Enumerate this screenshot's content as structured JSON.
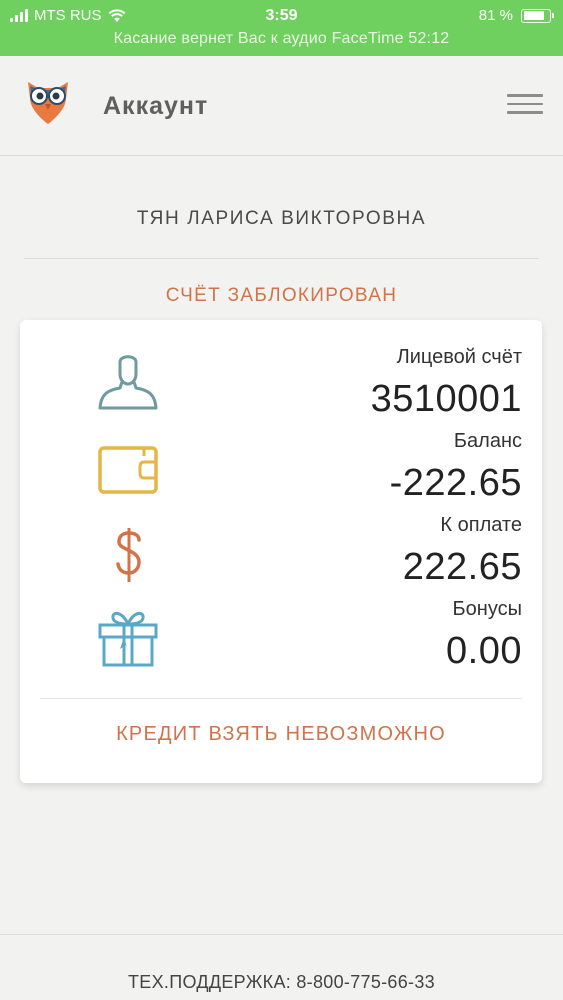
{
  "status_bar": {
    "carrier": "MTS RUS",
    "time": "3:59",
    "battery_percent": "81 %",
    "battery_level": 0.81,
    "facetime_banner": "Касание вернет Вас к аудио FaceTime 52:12",
    "color": "#6fcf5f"
  },
  "header": {
    "title": "Аккаунт",
    "logo_icon": "owl-logo-icon",
    "menu_icon": "hamburger-menu-icon"
  },
  "account": {
    "holder_name": "ТЯН ЛАРИСА ВИКТОРОВНА",
    "status": "СЧЁТ ЗАБЛОКИРОВАН",
    "stats": [
      {
        "label": "Лицевой счёт",
        "value": "3510001",
        "icon": "user-icon",
        "color": "#6f9a9e"
      },
      {
        "label": "Баланс",
        "value": "-222.65",
        "icon": "wallet-icon",
        "color": "#e3b646"
      },
      {
        "label": "К оплате",
        "value": "222.65",
        "icon": "dollar-icon",
        "color": "#d2734a"
      },
      {
        "label": "Бонусы",
        "value": "0.00",
        "icon": "gift-icon",
        "color": "#5aa8c7"
      }
    ],
    "credit_notice": "КРЕДИТ ВЗЯТЬ НЕВОЗМОЖНО"
  },
  "footer": {
    "support": "ТЕХ.ПОДДЕРЖКА: 8-800-775-66-33"
  }
}
